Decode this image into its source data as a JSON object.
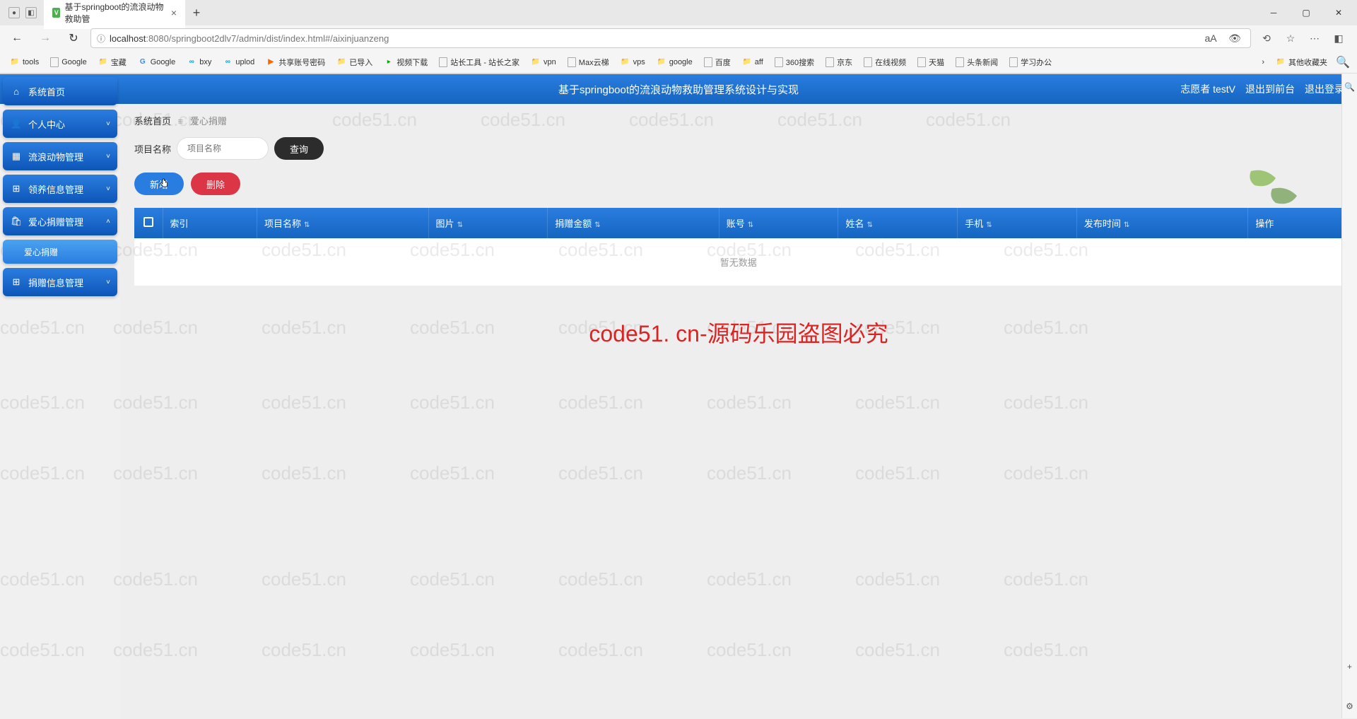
{
  "browser": {
    "tab_title": "基于springboot的流浪动物救助管",
    "url_host": "localhost",
    "url_port": ":8080",
    "url_path": "/springboot2dlv7/admin/dist/index.html#/aixinjuanzeng",
    "addr_icons": {
      "aa": "aA"
    },
    "bookmarks": [
      {
        "icon": "folder",
        "label": "tools"
      },
      {
        "icon": "page",
        "label": "Google"
      },
      {
        "icon": "folder",
        "label": "宝藏"
      },
      {
        "icon": "g",
        "label": "Google"
      },
      {
        "icon": "sp",
        "label": "bxy"
      },
      {
        "icon": "sp",
        "label": "uplod"
      },
      {
        "icon": "orange",
        "label": "共享账号密码"
      },
      {
        "icon": "folder",
        "label": "已导入"
      },
      {
        "icon": "green",
        "label": "视频下载"
      },
      {
        "icon": "page",
        "label": "站长工具 - 站长之家"
      },
      {
        "icon": "folder",
        "label": "vpn"
      },
      {
        "icon": "page",
        "label": "Max云梯"
      },
      {
        "icon": "folder",
        "label": "vps"
      },
      {
        "icon": "folder",
        "label": "google"
      },
      {
        "icon": "page",
        "label": "百度"
      },
      {
        "icon": "folder",
        "label": "aff"
      },
      {
        "icon": "page",
        "label": "360搜索"
      },
      {
        "icon": "page",
        "label": "京东"
      },
      {
        "icon": "page",
        "label": "在线视频"
      },
      {
        "icon": "page",
        "label": "天猫"
      },
      {
        "icon": "page",
        "label": "头条新闻"
      },
      {
        "icon": "page",
        "label": "学习办公"
      }
    ],
    "overflow_bookmark": "其他收藏夹"
  },
  "header": {
    "title": "基于springboot的流浪动物救助管理系统设计与实现",
    "user_role": "志愿者 testV",
    "logout_front": "退出到前台",
    "logout": "退出登录"
  },
  "sidebar": {
    "items": [
      {
        "icon": "home",
        "label": "系统首页",
        "caret": false
      },
      {
        "icon": "user",
        "label": "个人中心",
        "caret": true
      },
      {
        "icon": "box",
        "label": "流浪动物管理",
        "caret": true
      },
      {
        "icon": "grid",
        "label": "领养信息管理",
        "caret": true
      },
      {
        "icon": "bag",
        "label": "爱心捐赠管理",
        "caret": true,
        "caret_up": true
      },
      {
        "icon": "",
        "label": "爱心捐赠",
        "caret": false,
        "sub": true
      },
      {
        "icon": "grid",
        "label": "捐赠信息管理",
        "caret": true
      }
    ]
  },
  "breadcrumb": {
    "home": "系统首页",
    "current": "爱心捐赠"
  },
  "search": {
    "label": "项目名称",
    "placeholder": "项目名称",
    "btn": "查询"
  },
  "actions": {
    "add": "新增",
    "delete": "删除"
  },
  "table": {
    "cols": [
      "索引",
      "项目名称",
      "图片",
      "捐赠金额",
      "账号",
      "姓名",
      "手机",
      "发布时间",
      "操作"
    ],
    "empty": "暂无数据"
  },
  "watermark": "code51. cn-源码乐园盗图必究",
  "wm_small": "code51.cn"
}
